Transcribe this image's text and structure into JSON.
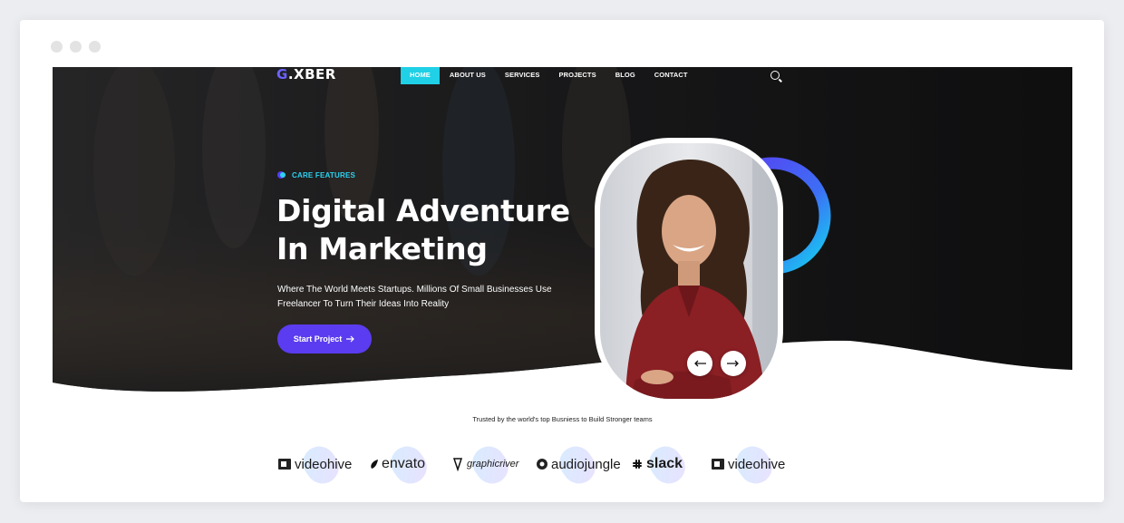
{
  "browser": {
    "dots": [
      "close",
      "minimize",
      "maximize"
    ]
  },
  "nav": {
    "logo_mark": "G",
    "logo_text": ".XBER",
    "items": [
      {
        "label": "HOME",
        "active": true
      },
      {
        "label": "ABOUT US",
        "active": false
      },
      {
        "label": "SERVICES",
        "active": false
      },
      {
        "label": "PROJECTS",
        "active": false
      },
      {
        "label": "BLOG",
        "active": false
      },
      {
        "label": "CONTACT",
        "active": false
      }
    ],
    "search_icon": "search-icon"
  },
  "hero": {
    "eyebrow": "CARE FEATURES",
    "title_line1": "Digital Adventure",
    "title_line2": "In Marketing",
    "subtitle_line1": "Where The World Meets Startups. Millions Of Small Businesses Use",
    "subtitle_line2": "Freelancer To Turn Their Ideas Into Reality",
    "cta_label": "Start Project",
    "cta_icon": "arrow-right-icon",
    "slider_prev_icon": "arrow-left-icon",
    "slider_next_icon": "arrow-right-icon"
  },
  "trusted": {
    "text": "Trusted by the world's top Busniess to Build Stronger teams",
    "brands": [
      "videohive",
      "envato",
      "graphicriver",
      "audiojungle",
      "slack",
      "videohive"
    ]
  },
  "colors": {
    "accent_primary": "#5b3cf0",
    "accent_cyan": "#1fd0e6",
    "hero_dark": "#1c1c1e"
  }
}
